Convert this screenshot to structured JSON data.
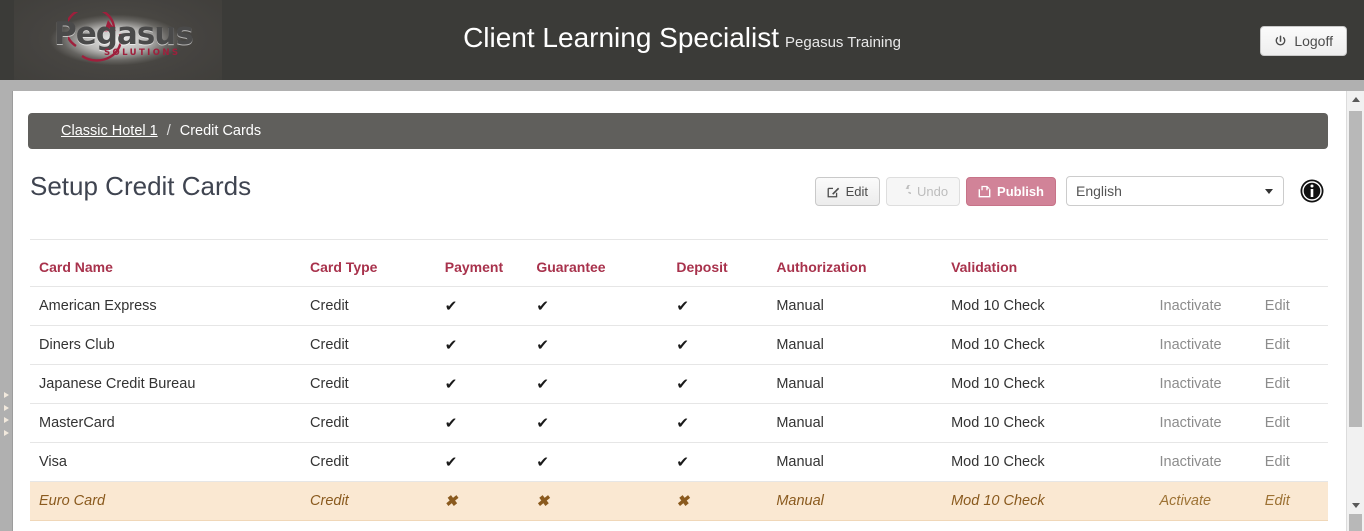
{
  "header": {
    "logo_word": "Pegasus",
    "logo_sub": "SOLUTIONS",
    "title": "Client Learning Specialist",
    "subtitle": "Pegasus Training",
    "logoff_label": "Logoff",
    "bar_color": "#3b3b38"
  },
  "breadcrumb": {
    "link": "Classic Hotel 1",
    "separator": "/",
    "current": "Credit Cards"
  },
  "page": {
    "title": "Setup Credit Cards"
  },
  "toolbar": {
    "edit_label": "Edit",
    "undo_label": "Undo",
    "publish_label": "Publish",
    "publish_color": "#d18398",
    "language_value": "English",
    "language_options": [
      "English"
    ],
    "info_label": "i"
  },
  "table": {
    "headers": [
      "Card Name",
      "Card Type",
      "Payment",
      "Guarantee",
      "Deposit",
      "Authorization",
      "Validation",
      "",
      ""
    ],
    "header_color": "#a8324c",
    "mark_yes": "✔",
    "mark_no": "✖",
    "rows": [
      {
        "name": "American Express",
        "type": "Credit",
        "payment": "✔",
        "guarantee": "✔",
        "deposit": "✔",
        "authorization": "Manual",
        "validation": "Mod 10 Check",
        "toggle_action": "Inactivate",
        "edit_action": "Edit",
        "pending": false
      },
      {
        "name": "Diners Club",
        "type": "Credit",
        "payment": "✔",
        "guarantee": "✔",
        "deposit": "✔",
        "authorization": "Manual",
        "validation": "Mod 10 Check",
        "toggle_action": "Inactivate",
        "edit_action": "Edit",
        "pending": false
      },
      {
        "name": "Japanese Credit Bureau",
        "type": "Credit",
        "payment": "✔",
        "guarantee": "✔",
        "deposit": "✔",
        "authorization": "Manual",
        "validation": "Mod 10 Check",
        "toggle_action": "Inactivate",
        "edit_action": "Edit",
        "pending": false
      },
      {
        "name": "MasterCard",
        "type": "Credit",
        "payment": "✔",
        "guarantee": "✔",
        "deposit": "✔",
        "authorization": "Manual",
        "validation": "Mod 10 Check",
        "toggle_action": "Inactivate",
        "edit_action": "Edit",
        "pending": false
      },
      {
        "name": "Visa",
        "type": "Credit",
        "payment": "✔",
        "guarantee": "✔",
        "deposit": "✔",
        "authorization": "Manual",
        "validation": "Mod 10 Check",
        "toggle_action": "Inactivate",
        "edit_action": "Edit",
        "pending": false
      },
      {
        "name": "Euro Card",
        "type": "Credit",
        "payment": "✖",
        "guarantee": "✖",
        "deposit": "✖",
        "authorization": "Manual",
        "validation": "Mod 10 Check",
        "toggle_action": "Activate",
        "edit_action": "Edit",
        "pending": true
      }
    ],
    "pending_row_bg": "#fae8d2"
  }
}
